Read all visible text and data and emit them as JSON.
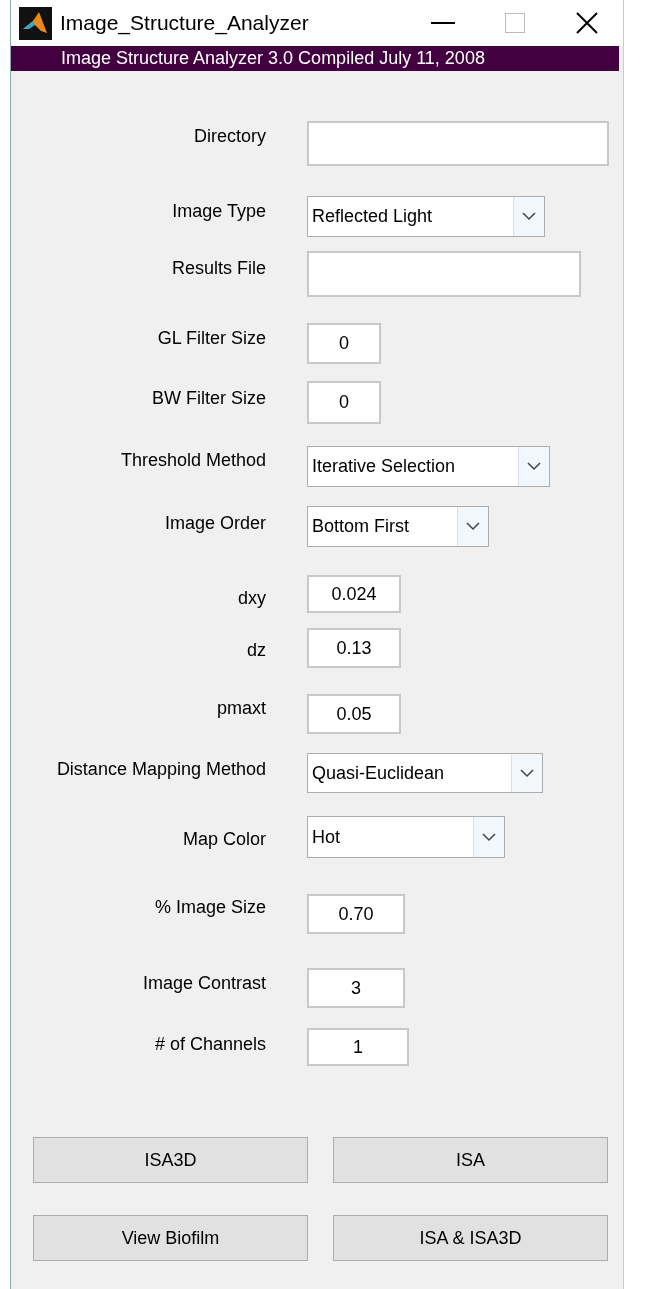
{
  "window": {
    "title": "Image_Structure_Analyzer"
  },
  "banner": "Image Structure Analyzer 3.0 Compiled July 11, 2008",
  "rows": [
    {
      "label": "Directory",
      "kind": "field",
      "value": ""
    },
    {
      "label": "Image Type",
      "kind": "dropdown",
      "value": "Reflected Light"
    },
    {
      "label": "Results File",
      "kind": "field",
      "value": ""
    },
    {
      "label": "GL Filter Size",
      "kind": "field",
      "value": "0"
    },
    {
      "label": "BW Filter Size",
      "kind": "field",
      "value": "0"
    },
    {
      "label": "Threshold Method",
      "kind": "dropdown",
      "value": "Iterative Selection"
    },
    {
      "label": "Image Order",
      "kind": "dropdown",
      "value": "Bottom First"
    },
    {
      "label": "dxy",
      "kind": "field",
      "value": "0.024"
    },
    {
      "label": "dz",
      "kind": "field",
      "value": "0.13"
    },
    {
      "label": "pmaxt",
      "kind": "field",
      "value": "0.05"
    },
    {
      "label": "Distance Mapping Method",
      "kind": "dropdown",
      "value": "Quasi-Euclidean"
    },
    {
      "label": "Map Color",
      "kind": "dropdown",
      "value": "Hot"
    },
    {
      "label": "% Image Size",
      "kind": "field",
      "value": "0.70"
    },
    {
      "label": "Image Contrast",
      "kind": "field",
      "value": "3"
    },
    {
      "label": "# of Channels",
      "kind": "field",
      "value": "1"
    }
  ],
  "buttons": [
    "ISA3D",
    "ISA",
    "View Biofilm",
    "ISA & ISA3D"
  ]
}
